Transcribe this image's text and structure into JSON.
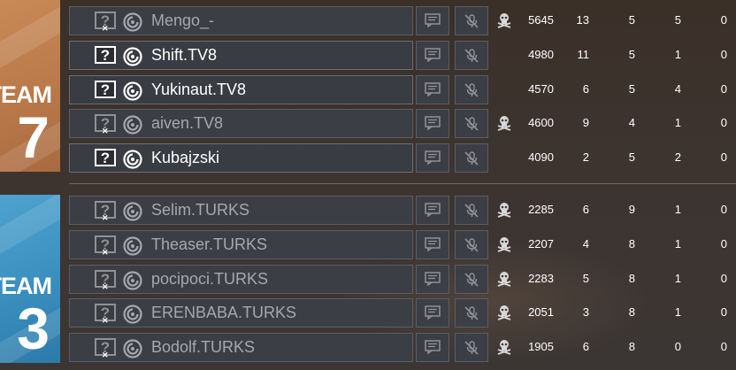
{
  "team_7": {
    "label_word": "TEAM",
    "label_number": "7",
    "color": "#c07f4f",
    "players": [
      {
        "name": "Mengo_-",
        "score": "5645",
        "kills": "13",
        "assists": "5",
        "deaths": "5",
        "ping": "0",
        "active": false,
        "status_icon": true
      },
      {
        "name": "Shift.TV8",
        "score": "4980",
        "kills": "11",
        "assists": "5",
        "deaths": "1",
        "ping": "0",
        "active": true,
        "status_icon": false
      },
      {
        "name": "Yukinaut.TV8",
        "score": "4570",
        "kills": "6",
        "assists": "5",
        "deaths": "4",
        "ping": "0",
        "active": true,
        "status_icon": false
      },
      {
        "name": "aiven.TV8",
        "score": "4600",
        "kills": "9",
        "assists": "4",
        "deaths": "1",
        "ping": "0",
        "active": false,
        "status_icon": true
      },
      {
        "name": "Kubajzski",
        "score": "4090",
        "kills": "2",
        "assists": "5",
        "deaths": "2",
        "ping": "0",
        "active": true,
        "status_icon": false
      }
    ]
  },
  "team_3": {
    "label_word": "TEAM",
    "label_number": "3",
    "color": "#3e93c4",
    "players": [
      {
        "name": "Selim.TURKS",
        "score": "2285",
        "kills": "6",
        "assists": "9",
        "deaths": "1",
        "ping": "0",
        "active": false,
        "status_icon": true
      },
      {
        "name": "Theaser.TURKS",
        "score": "2207",
        "kills": "4",
        "assists": "8",
        "deaths": "1",
        "ping": "0",
        "active": false,
        "status_icon": true
      },
      {
        "name": "pocipoci.TURKS",
        "score": "2283",
        "kills": "5",
        "assists": "8",
        "deaths": "1",
        "ping": "0",
        "active": false,
        "status_icon": true
      },
      {
        "name": "ERENBABA.TURKS",
        "score": "2051",
        "kills": "3",
        "assists": "8",
        "deaths": "1",
        "ping": "0",
        "active": false,
        "status_icon": true
      },
      {
        "name": "Bodolf.TURKS",
        "score": "1905",
        "kills": "6",
        "assists": "8",
        "deaths": "0",
        "ping": "0",
        "active": false,
        "status_icon": true
      }
    ]
  },
  "icons": {
    "unknown_operator": "question-mark-icon",
    "platform": "ubisoft-logo-icon",
    "chat": "chat-icon",
    "mute": "muted-microphone-icon",
    "status": "dead-skull-icon"
  }
}
